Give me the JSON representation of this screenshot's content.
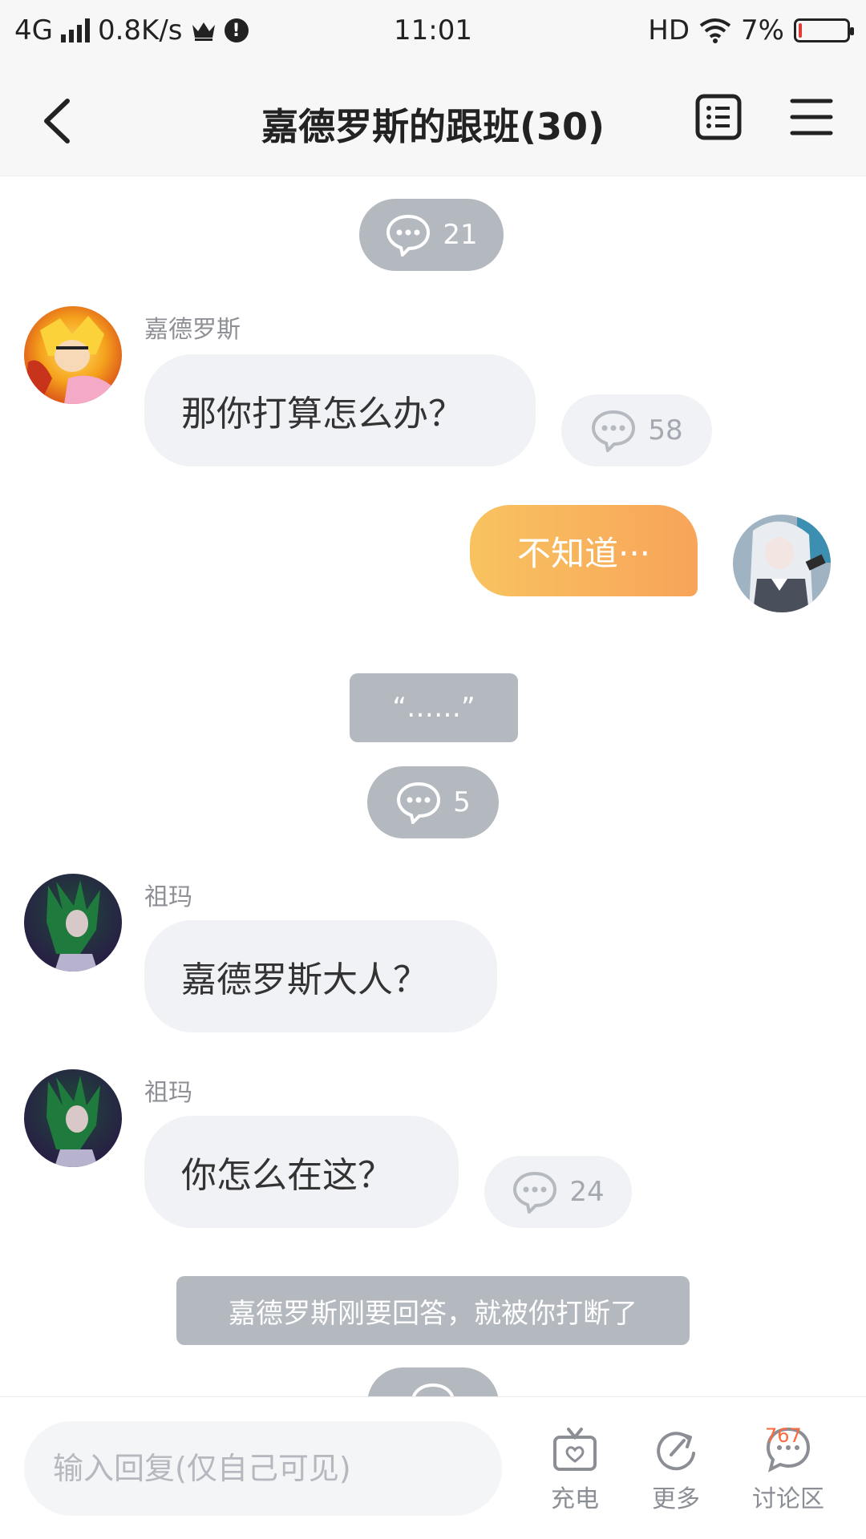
{
  "status_bar": {
    "network": "4G",
    "speed": "0.8K/s",
    "time": "11:01",
    "hd": "HD",
    "battery": "7%",
    "battery_level": 0.07
  },
  "header": {
    "title": "嘉德罗斯的跟班(30)"
  },
  "chat": {
    "top_comment_count": "21",
    "messages": [
      {
        "sender": "嘉德罗斯",
        "text": "那你打算怎么办？",
        "comment_count": "58"
      },
      {
        "text": "不知道···"
      },
      {
        "sender": "祖玛",
        "text": "嘉德罗斯大人？"
      },
      {
        "sender": "祖玛",
        "text": "你怎么在这？",
        "comment_count": "24"
      }
    ],
    "narration_1": "“……”",
    "narration_1_comments": "5",
    "narration_2": "嘉德罗斯刚要回答，就被你打断了"
  },
  "bottom_bar": {
    "input_placeholder": "输入回复(仅自己可见)",
    "charge_label": "充电",
    "more_label": "更多",
    "discussion_label": "讨论区",
    "discussion_badge": "767"
  },
  "colors": {
    "accent_gradient_start": "#f8c35f",
    "accent_gradient_end": "#f8a45a",
    "badge": "#ff6a3d",
    "bubble_gray": "#f1f2f5",
    "narration_gray": "#b4b8bf"
  }
}
